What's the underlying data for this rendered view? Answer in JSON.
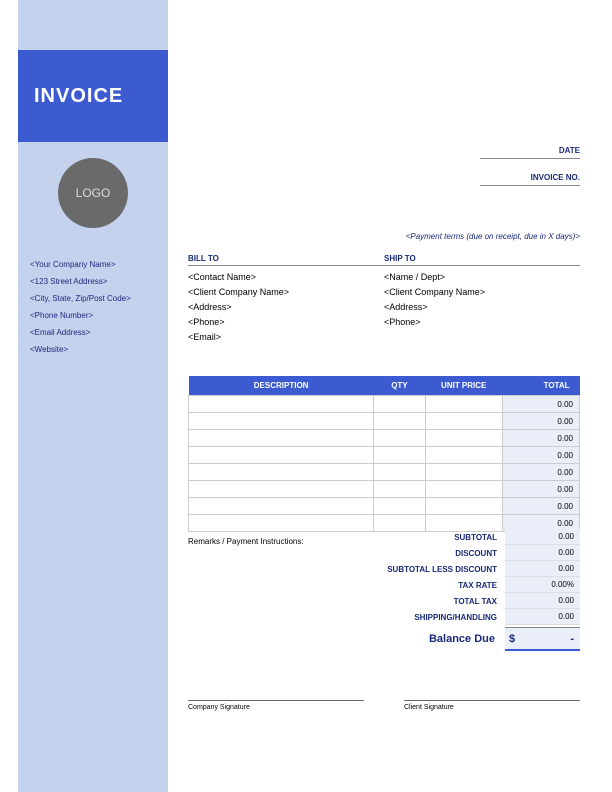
{
  "title": "INVOICE",
  "logo_text": "LOGO",
  "company": {
    "name": "<Your Company Name>",
    "address": "<123 Street Address>",
    "city": "<City, State, Zip/Post Code>",
    "phone": "<Phone Number>",
    "email": "<Email Address>",
    "website": "<Website>"
  },
  "meta": {
    "date_label": "DATE",
    "invoice_no_label": "INVOICE NO.",
    "payment_terms": "<Payment terms (due on receipt, due in X days)>"
  },
  "bill_to": {
    "header": "BILL TO",
    "contact": "<Contact Name>",
    "company": "<Client Company Name>",
    "address": "<Address>",
    "phone": "<Phone>",
    "email": "<Email>"
  },
  "ship_to": {
    "header": "SHIP TO",
    "name": "<Name / Dept>",
    "company": "<Client Company Name>",
    "address": "<Address>",
    "phone": "<Phone>"
  },
  "table": {
    "headers": {
      "description": "DESCRIPTION",
      "qty": "QTY",
      "unit_price": "UNIT PRICE",
      "total": "TOTAL"
    },
    "rows": [
      {
        "total": "0.00"
      },
      {
        "total": "0.00"
      },
      {
        "total": "0.00"
      },
      {
        "total": "0.00"
      },
      {
        "total": "0.00"
      },
      {
        "total": "0.00"
      },
      {
        "total": "0.00"
      },
      {
        "total": "0.00"
      }
    ]
  },
  "remarks_label": "Remarks / Payment Instructions:",
  "summary": {
    "subtotal": {
      "label": "SUBTOTAL",
      "value": "0.00"
    },
    "discount": {
      "label": "DISCOUNT",
      "value": "0.00"
    },
    "subtotal_less": {
      "label": "SUBTOTAL LESS DISCOUNT",
      "value": "0.00"
    },
    "tax_rate": {
      "label": "TAX RATE",
      "value": "0.00%"
    },
    "total_tax": {
      "label": "TOTAL TAX",
      "value": "0.00"
    },
    "shipping": {
      "label": "SHIPPING/HANDLING",
      "value": "0.00"
    },
    "balance": {
      "label": "Balance Due",
      "currency": "$",
      "value": "-"
    }
  },
  "signatures": {
    "company": "Company Signature",
    "client": "Client Signature"
  }
}
